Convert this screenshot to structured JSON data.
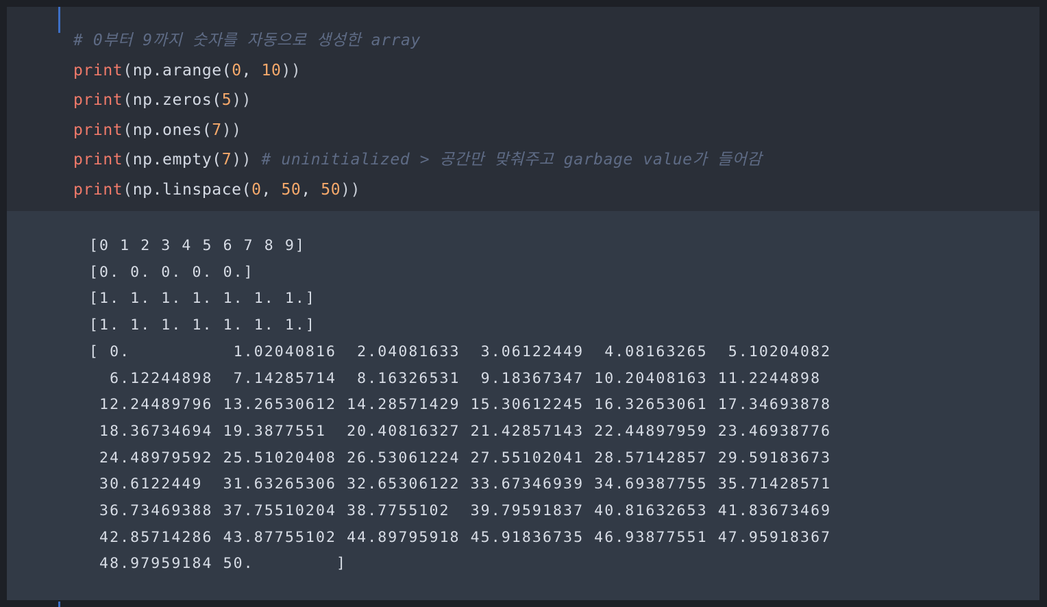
{
  "code": {
    "comment_line": "# 0부터 9까지 숫자를 자동으로 생성한 array",
    "lines": [
      {
        "fn": "print",
        "open": "(",
        "call": "np.arange(",
        "args": [
          {
            "num": "0"
          },
          {
            "sep": ", "
          },
          {
            "num": "10"
          }
        ],
        "close": "))",
        "comment": ""
      },
      {
        "fn": "print",
        "open": "(",
        "call": "np.zeros(",
        "args": [
          {
            "num": "5"
          }
        ],
        "close": "))",
        "comment": ""
      },
      {
        "fn": "print",
        "open": "(",
        "call": "np.ones(",
        "args": [
          {
            "num": "7"
          }
        ],
        "close": "))",
        "comment": ""
      },
      {
        "fn": "print",
        "open": "(",
        "call": "np.empty(",
        "args": [
          {
            "num": "7"
          }
        ],
        "close": "))",
        "comment": " # uninitialized > 공간만 맞춰주고 garbage value가 들어감"
      },
      {
        "fn": "print",
        "open": "(",
        "call": "np.linspace(",
        "args": [
          {
            "num": "0"
          },
          {
            "sep": ", "
          },
          {
            "num": "50"
          },
          {
            "sep": ", "
          },
          {
            "num": "50"
          }
        ],
        "close": "))",
        "comment": ""
      }
    ]
  },
  "output": {
    "lines": [
      "[0 1 2 3 4 5 6 7 8 9]",
      "[0. 0. 0. 0. 0.]",
      "[1. 1. 1. 1. 1. 1. 1.]",
      "[1. 1. 1. 1. 1. 1. 1.]",
      "[ 0.          1.02040816  2.04081633  3.06122449  4.08163265  5.10204082",
      "  6.12244898  7.14285714  8.16326531  9.18367347 10.20408163 11.2244898",
      " 12.24489796 13.26530612 14.28571429 15.30612245 16.32653061 17.34693878",
      " 18.36734694 19.3877551  20.40816327 21.42857143 22.44897959 23.46938776",
      " 24.48979592 25.51020408 26.53061224 27.55102041 28.57142857 29.59183673",
      " 30.6122449  31.63265306 32.65306122 33.67346939 34.69387755 35.71428571",
      " 36.73469388 37.75510204 38.7755102  39.79591837 40.81632653 41.83673469",
      " 42.85714286 43.87755102 44.89795918 45.91836735 46.93877551 47.95918367",
      " 48.97959184 50.        ]"
    ]
  }
}
